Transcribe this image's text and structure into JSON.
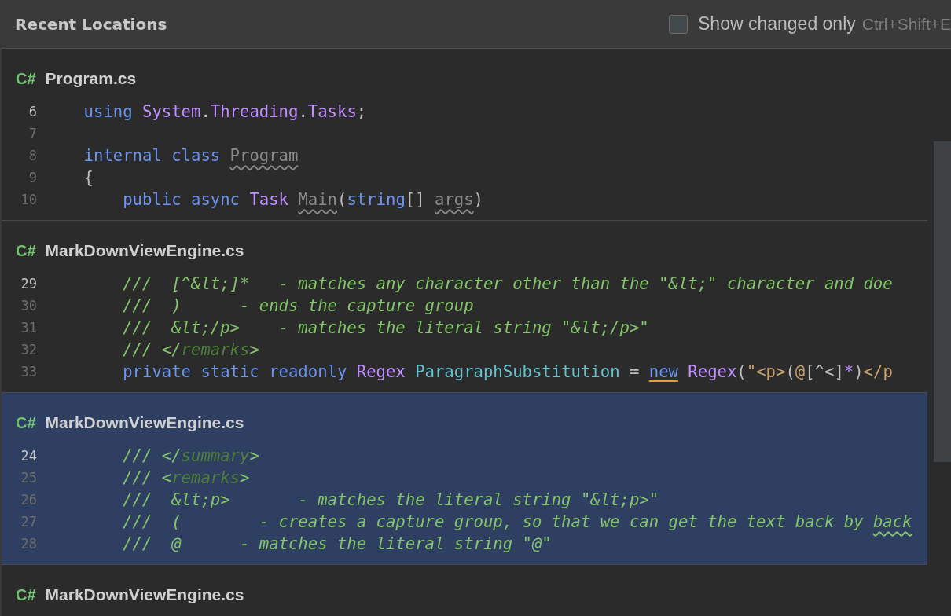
{
  "header": {
    "title": "Recent Locations",
    "show_changed_only": {
      "label": "Show changed only",
      "shortcut": "Ctrl+Shift+E",
      "checked": false
    }
  },
  "groups": [
    {
      "language": "C#",
      "file": "Program.cs",
      "selected": false,
      "lines": [
        {
          "number": "6",
          "current": true,
          "tokens": [
            {
              "text": "    using ",
              "kind": "keyword"
            },
            {
              "text": "System",
              "kind": "type"
            },
            {
              "text": ".",
              "kind": "plain"
            },
            {
              "text": "Threading",
              "kind": "type"
            },
            {
              "text": ".",
              "kind": "plain"
            },
            {
              "text": "Tasks",
              "kind": "type"
            },
            {
              "text": ";",
              "kind": "plain"
            }
          ]
        },
        {
          "number": "7",
          "current": false
        },
        {
          "number": "8",
          "current": false,
          "tokens": [
            {
              "text": "    internal class ",
              "kind": "keyword"
            },
            {
              "text": "Program",
              "kind": "unused"
            }
          ]
        },
        {
          "number": "9",
          "current": false,
          "tokens": [
            {
              "text": "    {",
              "kind": "plain"
            }
          ]
        },
        {
          "number": "10",
          "current": false,
          "tokens": [
            {
              "text": "        public async ",
              "kind": "keyword"
            },
            {
              "text": "Task ",
              "kind": "type"
            },
            {
              "text": "Main",
              "kind": "unused"
            },
            {
              "text": "(",
              "kind": "plain"
            },
            {
              "text": "string",
              "kind": "keyword"
            },
            {
              "text": "[] ",
              "kind": "plain"
            },
            {
              "text": "args",
              "kind": "unused"
            },
            {
              "text": ")",
              "kind": "plain"
            }
          ]
        }
      ]
    },
    {
      "language": "C#",
      "file": "MarkDownViewEngine.cs",
      "selected": false,
      "lines": [
        {
          "number": "29",
          "current": true,
          "tokens": [
            {
              "text": "        ///  [^&lt;]*   - matches any character other than the \"&lt;\" character and doe",
              "kind": "comment"
            }
          ]
        },
        {
          "number": "30",
          "current": false,
          "tokens": [
            {
              "text": "        ///  )      - ends the capture group",
              "kind": "comment"
            }
          ]
        },
        {
          "number": "31",
          "current": false,
          "tokens": [
            {
              "text": "        ///  &lt;/p>    - matches the literal string \"&lt;/p>\"",
              "kind": "comment"
            }
          ]
        },
        {
          "number": "32",
          "current": false,
          "tokens": [
            {
              "text": "        /// </",
              "kind": "comment"
            },
            {
              "text": "remarks",
              "kind": "doctag"
            },
            {
              "text": ">",
              "kind": "comment"
            }
          ]
        },
        {
          "number": "33",
          "current": false,
          "tokens": [
            {
              "text": "        private static readonly ",
              "kind": "keyword"
            },
            {
              "text": "Regex ",
              "kind": "type"
            },
            {
              "text": "ParagraphSubstitution",
              "kind": "field"
            },
            {
              "text": " = ",
              "kind": "plain"
            },
            {
              "text": "new",
              "kind": "marked-keyword"
            },
            {
              "text": " Regex",
              "kind": "type"
            },
            {
              "text": "(",
              "kind": "plain"
            },
            {
              "text": "\"<p>",
              "kind": "string"
            },
            {
              "text": "(",
              "kind": "plain"
            },
            {
              "text": "@",
              "kind": "string"
            },
            {
              "text": "[^<]",
              "kind": "plain"
            },
            {
              "text": "*",
              "kind": "type"
            },
            {
              "text": ")",
              "kind": "plain"
            },
            {
              "text": "</p",
              "kind": "string"
            }
          ]
        }
      ]
    },
    {
      "language": "C#",
      "file": "MarkDownViewEngine.cs",
      "selected": true,
      "lines": [
        {
          "number": "24",
          "current": true,
          "tokens": [
            {
              "text": "        /// </",
              "kind": "comment"
            },
            {
              "text": "summary",
              "kind": "doctag"
            },
            {
              "text": ">",
              "kind": "comment"
            }
          ]
        },
        {
          "number": "25",
          "current": false,
          "tokens": [
            {
              "text": "        /// <",
              "kind": "comment"
            },
            {
              "text": "remarks",
              "kind": "doctag"
            },
            {
              "text": ">",
              "kind": "comment"
            }
          ]
        },
        {
          "number": "26",
          "current": false,
          "tokens": [
            {
              "text": "        ///  &lt;p>       - matches the literal string \"&lt;p>\"",
              "kind": "comment"
            }
          ]
        },
        {
          "number": "27",
          "current": false,
          "tokens": [
            {
              "text": "        ///  (        - creates a capture group, so that we can get the text back by ",
              "kind": "comment"
            },
            {
              "text": "back",
              "kind": "typo-comment"
            }
          ]
        },
        {
          "number": "28",
          "current": false,
          "tokens": [
            {
              "text": "        ///  @      - matches the literal string \"@\"",
              "kind": "comment"
            }
          ]
        }
      ]
    },
    {
      "language": "C#",
      "file": "MarkDownViewEngine.cs",
      "selected": false
    }
  ]
}
